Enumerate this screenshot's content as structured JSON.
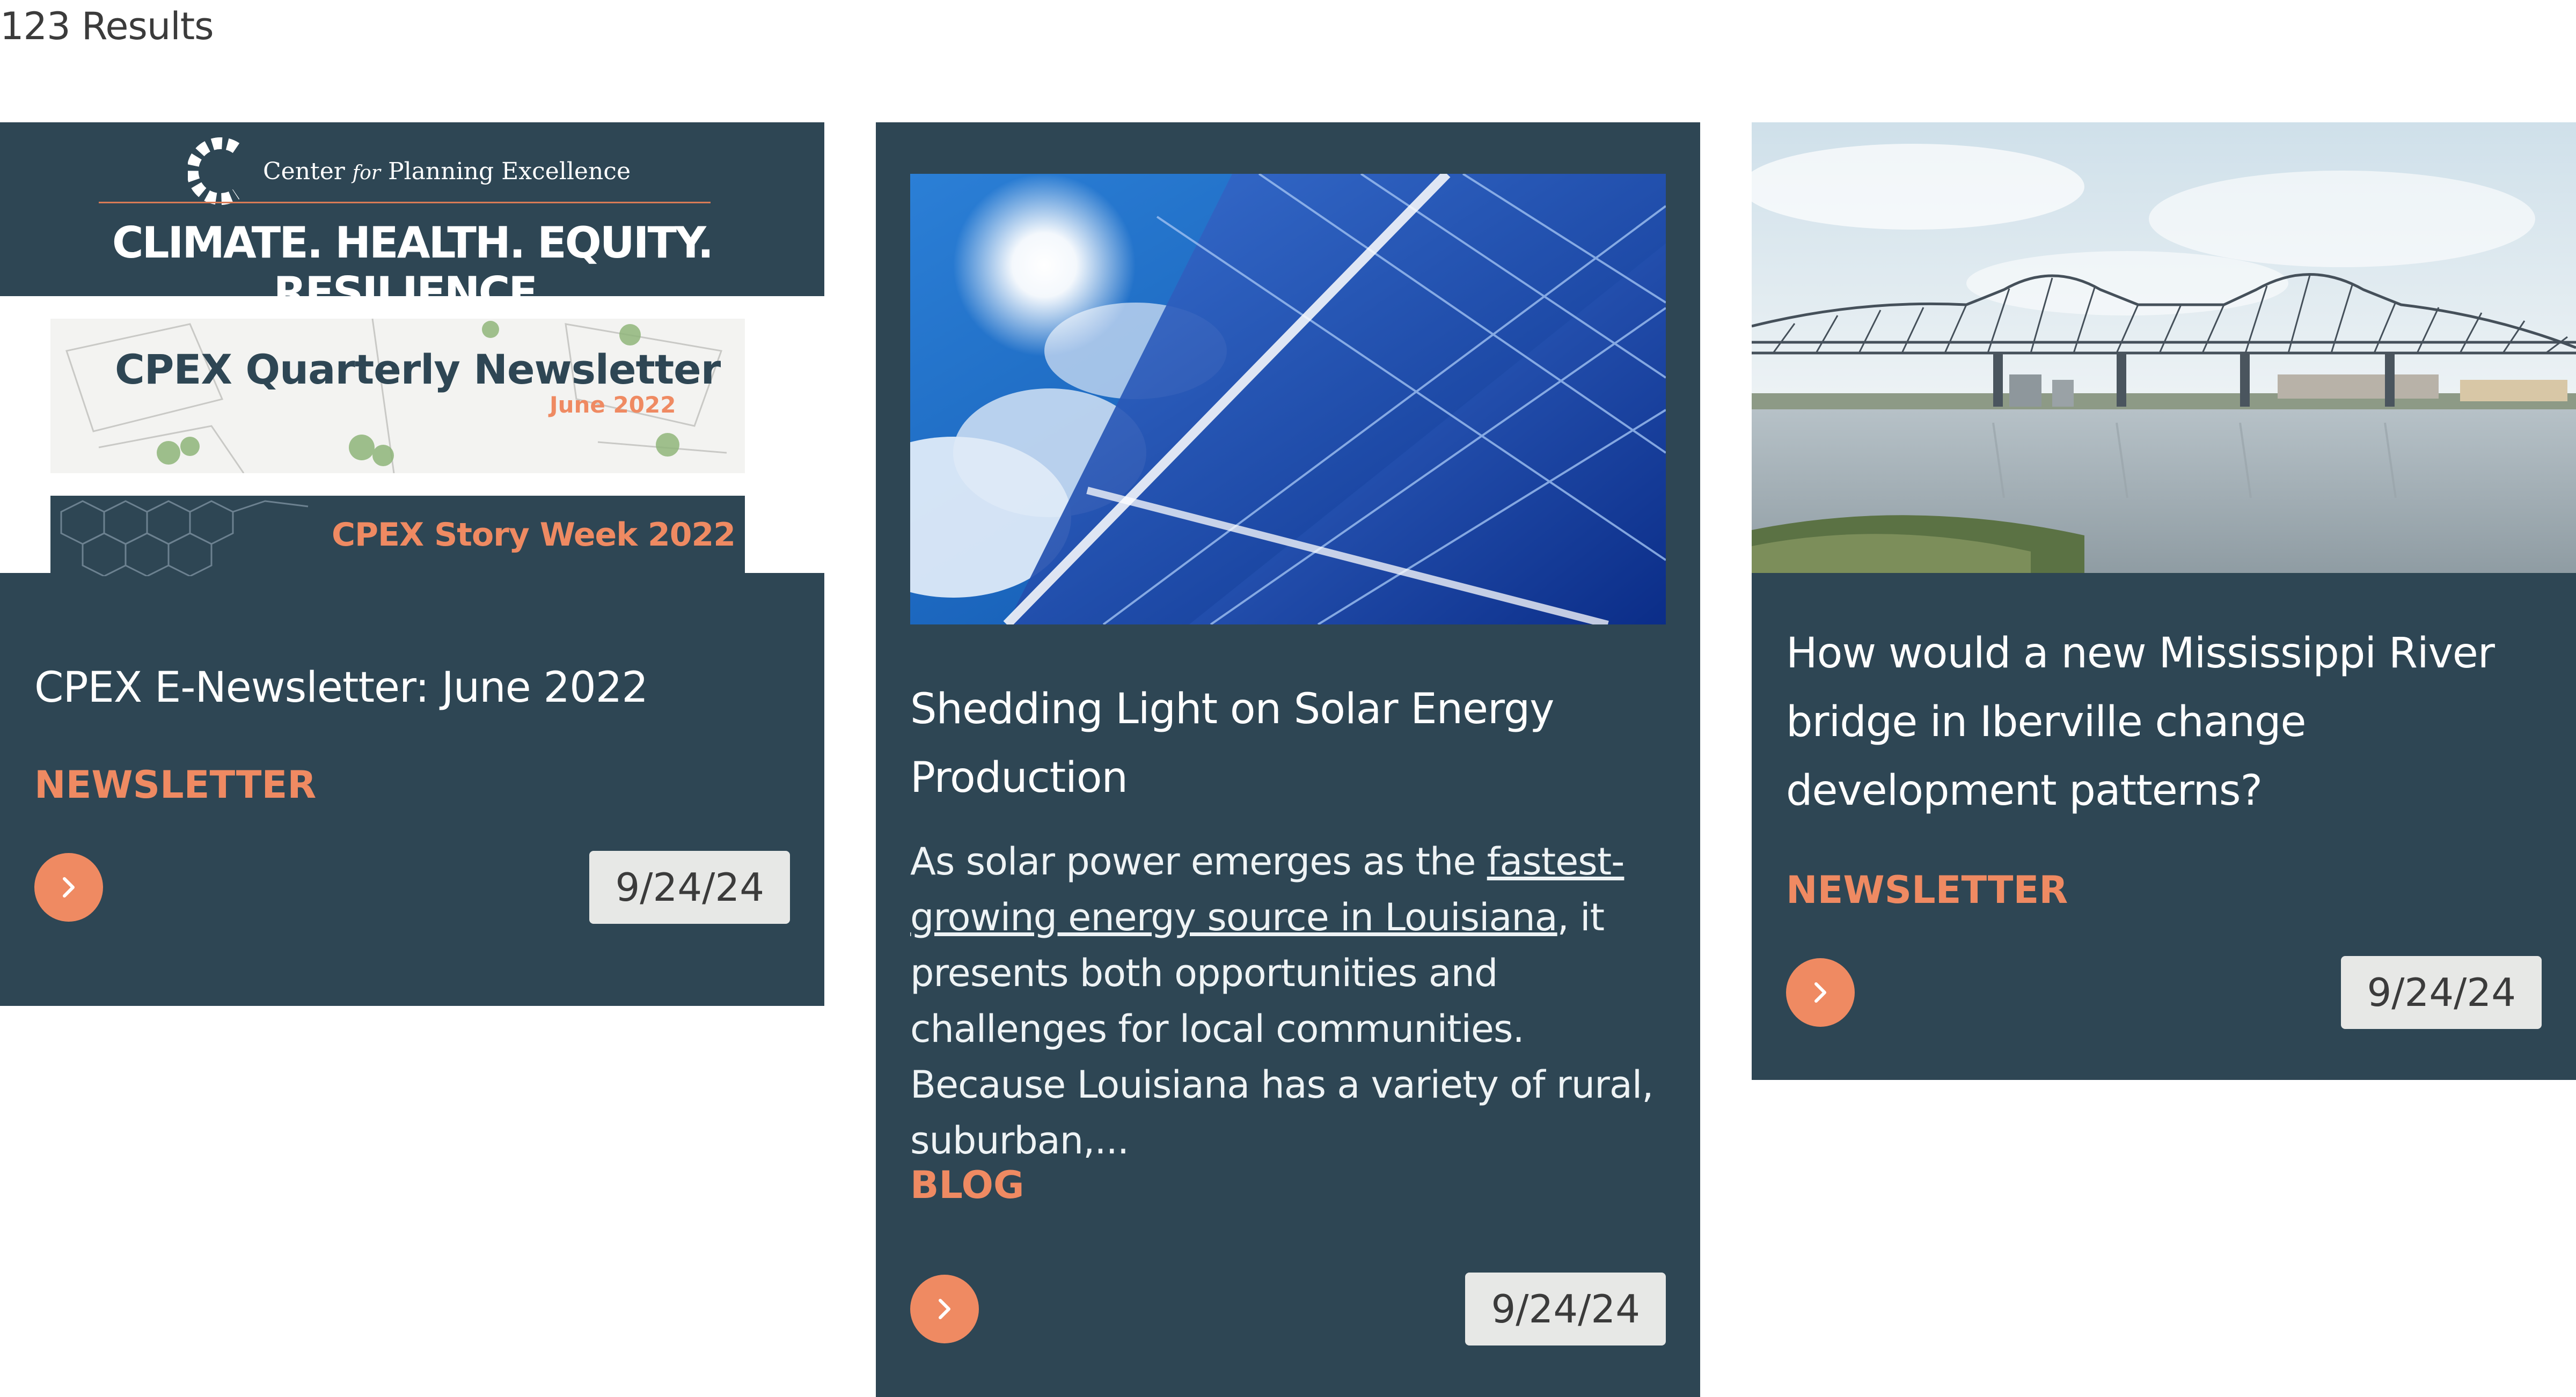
{
  "results": {
    "count_label": "123 Results"
  },
  "cards": [
    {
      "image": {
        "org_name_a": "Center",
        "org_name_for": "for",
        "org_name_b": "Planning Excellence",
        "tagline": "CLIMATE. HEALTH. EQUITY. RESILIENCE.",
        "banner_title": "CPEX Quarterly Newsletter",
        "banner_date": "June 2022",
        "story_week": "CPEX Story Week 2022"
      },
      "title": "CPEX E-Newsletter: June 2022",
      "category": "NEWSLETTER",
      "date": "9/24/24",
      "arrow_icon": "chevron-right-icon"
    },
    {
      "title": "Shedding Light on Solar Energy Production",
      "excerpt_before": "As solar power emerges as the ",
      "excerpt_link": "fastest-growing energy source in Louisiana",
      "excerpt_after": ", it presents both opportunities and challenges for local communities. Because Louisiana has a variety of rural, suburban,...",
      "category": "BLOG",
      "date": "9/24/24",
      "arrow_icon": "chevron-right-icon"
    },
    {
      "title": "How would a new Mississippi River bridge in Iberville change development patterns?",
      "category": "NEWSLETTER",
      "date": "9/24/24",
      "arrow_icon": "chevron-right-icon"
    }
  ],
  "colors": {
    "card_bg": "#2e4654",
    "accent": "#ef8a62",
    "date_badge_bg": "#e7e8e6"
  }
}
